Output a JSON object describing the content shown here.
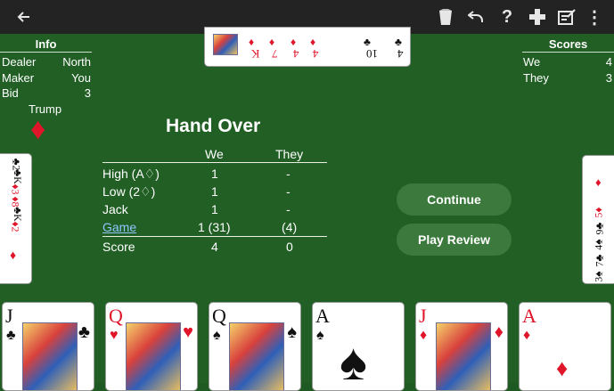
{
  "toolbar": {
    "back_icon": "arrow-left-icon",
    "icons": [
      "card-deck-icon",
      "undo-icon",
      "help-icon",
      "dpad-icon",
      "score-sheet-icon",
      "overflow-menu-icon"
    ],
    "help_glyph": "?",
    "menu_glyph": "⋮"
  },
  "info": {
    "title": "Info",
    "rows": [
      {
        "label": "Dealer",
        "value": "North"
      },
      {
        "label": "Maker",
        "value": "You"
      },
      {
        "label": "Bid",
        "value": "3"
      }
    ],
    "trump_label": "Trump",
    "trump_suit": "♦"
  },
  "scores": {
    "title": "Scores",
    "rows": [
      {
        "label": "We",
        "value": "4"
      },
      {
        "label": "They",
        "value": "3"
      }
    ]
  },
  "hand_over": {
    "title": "Hand Over",
    "headers": [
      "We",
      "They"
    ],
    "rows": [
      {
        "label": "High (A♢)",
        "we": "1",
        "they": "-"
      },
      {
        "label": "Low (2♢)",
        "we": "1",
        "they": "-"
      },
      {
        "label": "Jack",
        "we": "1",
        "they": "-"
      },
      {
        "label": "Game",
        "we": "1 (31)",
        "they": "(4)"
      }
    ],
    "total": {
      "label": "Score",
      "we": "4",
      "they": "0"
    }
  },
  "buttons": {
    "continue": "Continue",
    "play_review": "Play Review"
  },
  "top_cards": [
    "K",
    "7",
    "4",
    "4",
    "10",
    "4"
  ],
  "top_suits": [
    "♦",
    "♦",
    "♦",
    "♦",
    "♣",
    "♣"
  ],
  "left_cards": [
    "2",
    "K",
    "3",
    "8",
    "K",
    "2"
  ],
  "left_suits": [
    "♣",
    "♣",
    "♦",
    "♦",
    "♣",
    "♦"
  ],
  "right_cards": [
    "3",
    "7",
    "4",
    "9",
    "5"
  ],
  "right_suits": [
    "♠",
    "♣",
    "♠",
    "♣",
    "♦"
  ],
  "hand": [
    {
      "rank": "J",
      "suit": "♣"
    },
    {
      "rank": "Q",
      "suit": "♥"
    },
    {
      "rank": "Q",
      "suit": "♠"
    },
    {
      "rank": "A",
      "suit": "♠"
    },
    {
      "rank": "J",
      "suit": "♦"
    },
    {
      "rank": "A",
      "suit": "♦"
    }
  ],
  "colors": {
    "felt": "#215f25",
    "toolbar": "#232323",
    "button": "#3b7a3c",
    "red_suit": "#e0152a",
    "link": "#8ec7ff"
  }
}
